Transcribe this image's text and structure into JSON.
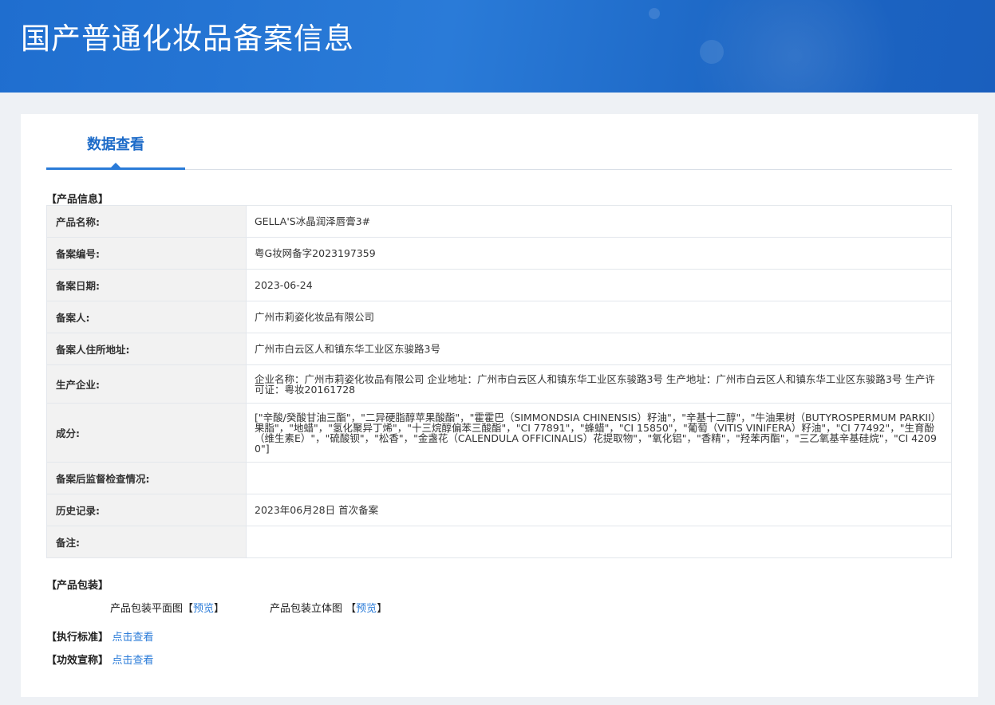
{
  "header": {
    "title": "国产普通化妆品备案信息"
  },
  "tabs": [
    {
      "label": "数据查看",
      "active": true
    }
  ],
  "product_info": {
    "section_label": "【产品信息】",
    "rows": [
      {
        "key": "产品名称:",
        "value": "GELLA'S冰晶润泽唇膏3#"
      },
      {
        "key": "备案编号:",
        "value": "粤G妆网备字2023197359"
      },
      {
        "key": "备案日期:",
        "value": "2023-06-24"
      },
      {
        "key": "备案人:",
        "value": "广州市莉姿化妆品有限公司"
      },
      {
        "key": "备案人住所地址:",
        "value": "广州市白云区人和镇东华工业区东骏路3号"
      },
      {
        "key": "生产企业:",
        "value": "企业名称：广州市莉姿化妆品有限公司 企业地址：广州市白云区人和镇东华工业区东骏路3号 生产地址：广州市白云区人和镇东华工业区东骏路3号 生产许可证：粤妆20161728"
      },
      {
        "key": "成分:",
        "value": "[\"辛酸/癸酸甘油三酯\"，\"二异硬脂醇苹果酸酯\"，\"霍霍巴（SIMMONDSIA CHINENSIS）籽油\"，\"辛基十二醇\"，\"牛油果树（BUTYROSPERMUM PARKII）果脂\"，\"地蜡\"，\"氢化聚异丁烯\"，\"十三烷醇偏苯三酸酯\"，\"CI 77891\"，\"蜂蜡\"，\"CI 15850\"，\"葡萄（VITIS VINIFERA）籽油\"，\"CI 77492\"，\"生育酚（维生素E）\"，\"硫酸钡\"，\"松香\"，\"金盏花（CALENDULA OFFICINALIS）花提取物\"，\"氧化铝\"，\"香精\"，\"羟苯丙酯\"，\"三乙氧基辛基硅烷\"，\"CI 42090\"]"
      },
      {
        "key": "备案后监督检查情况:",
        "value": ""
      },
      {
        "key": "历史记录:",
        "value": "2023年06月28日 首次备案"
      },
      {
        "key": "备注:",
        "value": ""
      }
    ]
  },
  "packaging": {
    "section_label": "【产品包装】",
    "flat_label": "产品包装平面图",
    "stereo_label": "产品包装立体图",
    "bracket_open": "【",
    "bracket_close": "】",
    "preview_link": "预览"
  },
  "standard": {
    "label": "【执行标准】",
    "link": "点击查看"
  },
  "efficacy": {
    "label": "【功效宣称】",
    "link": "点击查看"
  },
  "colors": {
    "banner": "#2a7bd8",
    "accent": "#1d6bc8",
    "link": "#2a7bd8",
    "table_border": "#9dbbe0"
  }
}
